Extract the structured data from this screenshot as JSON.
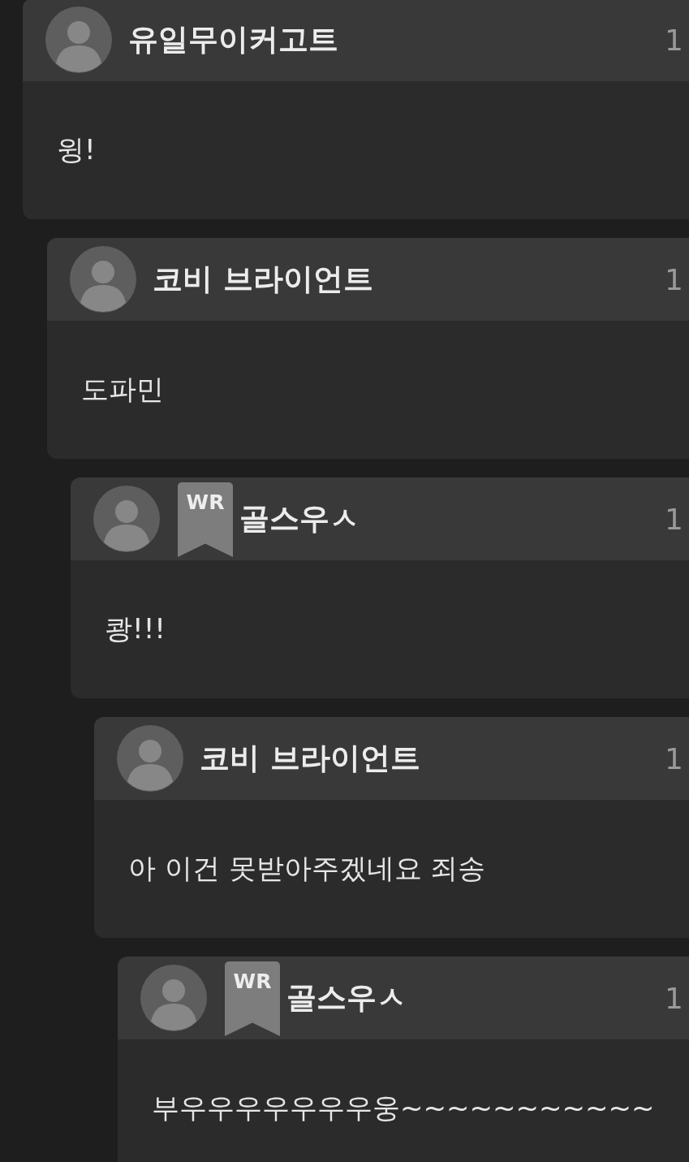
{
  "comments": [
    {
      "author": "유일무이커고트",
      "time": "1",
      "text": "윙!",
      "replies": [
        {
          "author": "코비 브라이언트",
          "time": "1",
          "text": "도파민",
          "replies": [
            {
              "author": "골스우ㅅ",
              "badge": "WR",
              "time": "1",
              "text": "쾅!!!",
              "replies": [
                {
                  "author": "코비 브라이언트",
                  "time": "1",
                  "text": "아 이건 못받아주겠네요 죄송",
                  "replies": [
                    {
                      "author": "골스우ㅅ",
                      "badge": "WR",
                      "time": "1",
                      "text": "부우우우우우우우웅~~~~~~~~~~~"
                    }
                  ]
                }
              ]
            }
          ]
        }
      ]
    }
  ]
}
